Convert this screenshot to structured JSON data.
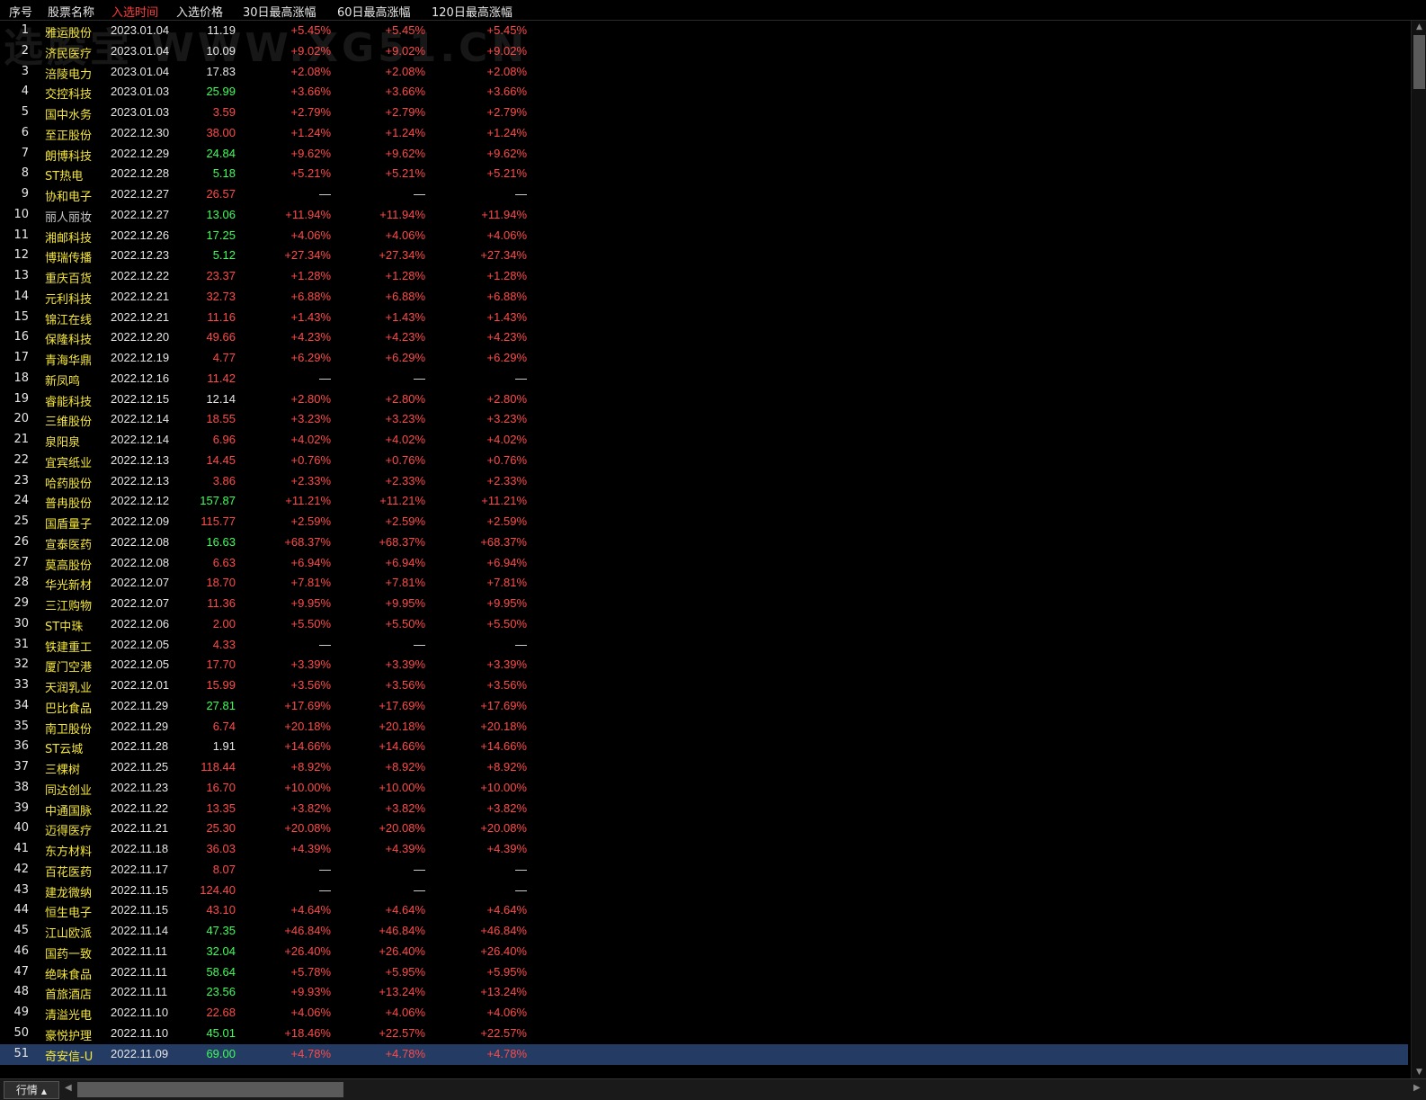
{
  "watermark": "选股宝 WWW.XG51.CN",
  "header": {
    "columns": [
      "序号",
      "股票名称",
      "入选时间",
      "入选价格",
      "30日最高涨幅",
      "60日最高涨幅",
      "120日最高涨幅"
    ],
    "active_column": "入选时间"
  },
  "colors": {
    "up": "#ff4a4a",
    "down": "#3dff5a",
    "flat": "#e6e6e6",
    "name": "#f5e63a",
    "selected_row_bg": "#243b63"
  },
  "rows": [
    {
      "idx": "1",
      "name": "雅运股份",
      "date": "2023.01.04",
      "price": "11.19",
      "pc": "white",
      "g30": "+5.45%",
      "g60": "+5.45%",
      "g120": "+5.45%"
    },
    {
      "idx": "2",
      "name": "济民医疗",
      "date": "2023.01.04",
      "price": "10.09",
      "pc": "white",
      "g30": "+9.02%",
      "g60": "+9.02%",
      "g120": "+9.02%"
    },
    {
      "idx": "3",
      "name": "涪陵电力",
      "date": "2023.01.04",
      "price": "17.83",
      "pc": "white",
      "g30": "+2.08%",
      "g60": "+2.08%",
      "g120": "+2.08%"
    },
    {
      "idx": "4",
      "name": "交控科技",
      "date": "2023.01.03",
      "price": "25.99",
      "pc": "green",
      "g30": "+3.66%",
      "g60": "+3.66%",
      "g120": "+3.66%"
    },
    {
      "idx": "5",
      "name": "国中水务",
      "date": "2023.01.03",
      "price": "3.59",
      "pc": "red",
      "g30": "+2.79%",
      "g60": "+2.79%",
      "g120": "+2.79%"
    },
    {
      "idx": "6",
      "name": "至正股份",
      "date": "2022.12.30",
      "price": "38.00",
      "pc": "red",
      "g30": "+1.24%",
      "g60": "+1.24%",
      "g120": "+1.24%"
    },
    {
      "idx": "7",
      "name": "朗博科技",
      "date": "2022.12.29",
      "price": "24.84",
      "pc": "green",
      "g30": "+9.62%",
      "g60": "+9.62%",
      "g120": "+9.62%"
    },
    {
      "idx": "8",
      "name": "ST热电",
      "date": "2022.12.28",
      "price": "5.18",
      "pc": "green",
      "g30": "+5.21%",
      "g60": "+5.21%",
      "g120": "+5.21%"
    },
    {
      "idx": "9",
      "name": "协和电子",
      "date": "2022.12.27",
      "price": "26.57",
      "pc": "red",
      "g30": "—",
      "g60": "—",
      "g120": "—"
    },
    {
      "idx": "10",
      "name": "丽人丽妆",
      "date": "2022.12.27",
      "price": "13.06",
      "pc": "green",
      "g30": "+11.94%",
      "g60": "+11.94%",
      "g120": "+11.94%",
      "dim": true
    },
    {
      "idx": "11",
      "name": "湘邮科技",
      "date": "2022.12.26",
      "price": "17.25",
      "pc": "green",
      "g30": "+4.06%",
      "g60": "+4.06%",
      "g120": "+4.06%"
    },
    {
      "idx": "12",
      "name": "博瑞传播",
      "date": "2022.12.23",
      "price": "5.12",
      "pc": "green",
      "g30": "+27.34%",
      "g60": "+27.34%",
      "g120": "+27.34%"
    },
    {
      "idx": "13",
      "name": "重庆百货",
      "date": "2022.12.22",
      "price": "23.37",
      "pc": "red",
      "g30": "+1.28%",
      "g60": "+1.28%",
      "g120": "+1.28%"
    },
    {
      "idx": "14",
      "name": "元利科技",
      "date": "2022.12.21",
      "price": "32.73",
      "pc": "red",
      "g30": "+6.88%",
      "g60": "+6.88%",
      "g120": "+6.88%"
    },
    {
      "idx": "15",
      "name": "锦江在线",
      "date": "2022.12.21",
      "price": "11.16",
      "pc": "red",
      "g30": "+1.43%",
      "g60": "+1.43%",
      "g120": "+1.43%"
    },
    {
      "idx": "16",
      "name": "保隆科技",
      "date": "2022.12.20",
      "price": "49.66",
      "pc": "red",
      "g30": "+4.23%",
      "g60": "+4.23%",
      "g120": "+4.23%"
    },
    {
      "idx": "17",
      "name": "青海华鼎",
      "date": "2022.12.19",
      "price": "4.77",
      "pc": "red",
      "g30": "+6.29%",
      "g60": "+6.29%",
      "g120": "+6.29%"
    },
    {
      "idx": "18",
      "name": "新凤鸣",
      "date": "2022.12.16",
      "price": "11.42",
      "pc": "red",
      "g30": "—",
      "g60": "—",
      "g120": "—"
    },
    {
      "idx": "19",
      "name": "睿能科技",
      "date": "2022.12.15",
      "price": "12.14",
      "pc": "white",
      "g30": "+2.80%",
      "g60": "+2.80%",
      "g120": "+2.80%"
    },
    {
      "idx": "20",
      "name": "三维股份",
      "date": "2022.12.14",
      "price": "18.55",
      "pc": "red",
      "g30": "+3.23%",
      "g60": "+3.23%",
      "g120": "+3.23%"
    },
    {
      "idx": "21",
      "name": "泉阳泉",
      "date": "2022.12.14",
      "price": "6.96",
      "pc": "red",
      "g30": "+4.02%",
      "g60": "+4.02%",
      "g120": "+4.02%"
    },
    {
      "idx": "22",
      "name": "宜宾纸业",
      "date": "2022.12.13",
      "price": "14.45",
      "pc": "red",
      "g30": "+0.76%",
      "g60": "+0.76%",
      "g120": "+0.76%"
    },
    {
      "idx": "23",
      "name": "哈药股份",
      "date": "2022.12.13",
      "price": "3.86",
      "pc": "red",
      "g30": "+2.33%",
      "g60": "+2.33%",
      "g120": "+2.33%"
    },
    {
      "idx": "24",
      "name": "普冉股份",
      "date": "2022.12.12",
      "price": "157.87",
      "pc": "green",
      "g30": "+11.21%",
      "g60": "+11.21%",
      "g120": "+11.21%"
    },
    {
      "idx": "25",
      "name": "国盾量子",
      "date": "2022.12.09",
      "price": "115.77",
      "pc": "red",
      "g30": "+2.59%",
      "g60": "+2.59%",
      "g120": "+2.59%"
    },
    {
      "idx": "26",
      "name": "宣泰医药",
      "date": "2022.12.08",
      "price": "16.63",
      "pc": "green",
      "g30": "+68.37%",
      "g60": "+68.37%",
      "g120": "+68.37%"
    },
    {
      "idx": "27",
      "name": "莫高股份",
      "date": "2022.12.08",
      "price": "6.63",
      "pc": "red",
      "g30": "+6.94%",
      "g60": "+6.94%",
      "g120": "+6.94%"
    },
    {
      "idx": "28",
      "name": "华光新材",
      "date": "2022.12.07",
      "price": "18.70",
      "pc": "red",
      "g30": "+7.81%",
      "g60": "+7.81%",
      "g120": "+7.81%"
    },
    {
      "idx": "29",
      "name": "三江购物",
      "date": "2022.12.07",
      "price": "11.36",
      "pc": "red",
      "g30": "+9.95%",
      "g60": "+9.95%",
      "g120": "+9.95%"
    },
    {
      "idx": "30",
      "name": "ST中珠",
      "date": "2022.12.06",
      "price": "2.00",
      "pc": "red",
      "g30": "+5.50%",
      "g60": "+5.50%",
      "g120": "+5.50%"
    },
    {
      "idx": "31",
      "name": "铁建重工",
      "date": "2022.12.05",
      "price": "4.33",
      "pc": "red",
      "g30": "—",
      "g60": "—",
      "g120": "—"
    },
    {
      "idx": "32",
      "name": "厦门空港",
      "date": "2022.12.05",
      "price": "17.70",
      "pc": "red",
      "g30": "+3.39%",
      "g60": "+3.39%",
      "g120": "+3.39%"
    },
    {
      "idx": "33",
      "name": "天润乳业",
      "date": "2022.12.01",
      "price": "15.99",
      "pc": "red",
      "g30": "+3.56%",
      "g60": "+3.56%",
      "g120": "+3.56%"
    },
    {
      "idx": "34",
      "name": "巴比食品",
      "date": "2022.11.29",
      "price": "27.81",
      "pc": "green",
      "g30": "+17.69%",
      "g60": "+17.69%",
      "g120": "+17.69%"
    },
    {
      "idx": "35",
      "name": "南卫股份",
      "date": "2022.11.29",
      "price": "6.74",
      "pc": "red",
      "g30": "+20.18%",
      "g60": "+20.18%",
      "g120": "+20.18%"
    },
    {
      "idx": "36",
      "name": "ST云城",
      "date": "2022.11.28",
      "price": "1.91",
      "pc": "white",
      "g30": "+14.66%",
      "g60": "+14.66%",
      "g120": "+14.66%"
    },
    {
      "idx": "37",
      "name": "三棵树",
      "date": "2022.11.25",
      "price": "118.44",
      "pc": "red",
      "g30": "+8.92%",
      "g60": "+8.92%",
      "g120": "+8.92%"
    },
    {
      "idx": "38",
      "name": "同达创业",
      "date": "2022.11.23",
      "price": "16.70",
      "pc": "red",
      "g30": "+10.00%",
      "g60": "+10.00%",
      "g120": "+10.00%"
    },
    {
      "idx": "39",
      "name": "中通国脉",
      "date": "2022.11.22",
      "price": "13.35",
      "pc": "red",
      "g30": "+3.82%",
      "g60": "+3.82%",
      "g120": "+3.82%"
    },
    {
      "idx": "40",
      "name": "迈得医疗",
      "date": "2022.11.21",
      "price": "25.30",
      "pc": "red",
      "g30": "+20.08%",
      "g60": "+20.08%",
      "g120": "+20.08%"
    },
    {
      "idx": "41",
      "name": "东方材料",
      "date": "2022.11.18",
      "price": "36.03",
      "pc": "red",
      "g30": "+4.39%",
      "g60": "+4.39%",
      "g120": "+4.39%"
    },
    {
      "idx": "42",
      "name": "百花医药",
      "date": "2022.11.17",
      "price": "8.07",
      "pc": "red",
      "g30": "—",
      "g60": "—",
      "g120": "—"
    },
    {
      "idx": "43",
      "name": "建龙微纳",
      "date": "2022.11.15",
      "price": "124.40",
      "pc": "red",
      "g30": "—",
      "g60": "—",
      "g120": "—"
    },
    {
      "idx": "44",
      "name": "恒生电子",
      "date": "2022.11.15",
      "price": "43.10",
      "pc": "red",
      "g30": "+4.64%",
      "g60": "+4.64%",
      "g120": "+4.64%"
    },
    {
      "idx": "45",
      "name": "江山欧派",
      "date": "2022.11.14",
      "price": "47.35",
      "pc": "green",
      "g30": "+46.84%",
      "g60": "+46.84%",
      "g120": "+46.84%"
    },
    {
      "idx": "46",
      "name": "国药一致",
      "date": "2022.11.11",
      "price": "32.04",
      "pc": "green",
      "g30": "+26.40%",
      "g60": "+26.40%",
      "g120": "+26.40%"
    },
    {
      "idx": "47",
      "name": "绝味食品",
      "date": "2022.11.11",
      "price": "58.64",
      "pc": "green",
      "g30": "+5.78%",
      "g60": "+5.95%",
      "g120": "+5.95%"
    },
    {
      "idx": "48",
      "name": "首旅酒店",
      "date": "2022.11.11",
      "price": "23.56",
      "pc": "green",
      "g30": "+9.93%",
      "g60": "+13.24%",
      "g120": "+13.24%"
    },
    {
      "idx": "49",
      "name": "清溢光电",
      "date": "2022.11.10",
      "price": "22.68",
      "pc": "red",
      "g30": "+4.06%",
      "g60": "+4.06%",
      "g120": "+4.06%"
    },
    {
      "idx": "50",
      "name": "豪悦护理",
      "date": "2022.11.10",
      "price": "45.01",
      "pc": "green",
      "g30": "+18.46%",
      "g60": "+22.57%",
      "g120": "+22.57%"
    },
    {
      "idx": "51",
      "name": "奇安信-U",
      "date": "2022.11.09",
      "price": "69.00",
      "pc": "green",
      "g30": "+4.78%",
      "g60": "+4.78%",
      "g120": "+4.78%",
      "selected": true
    }
  ],
  "bottombar": {
    "tab_label": "行情",
    "tab_arrow": "▲",
    "scroll_left": "◀",
    "scroll_right": "▶"
  },
  "vscroll": {
    "up": "▲",
    "down": "▼"
  }
}
